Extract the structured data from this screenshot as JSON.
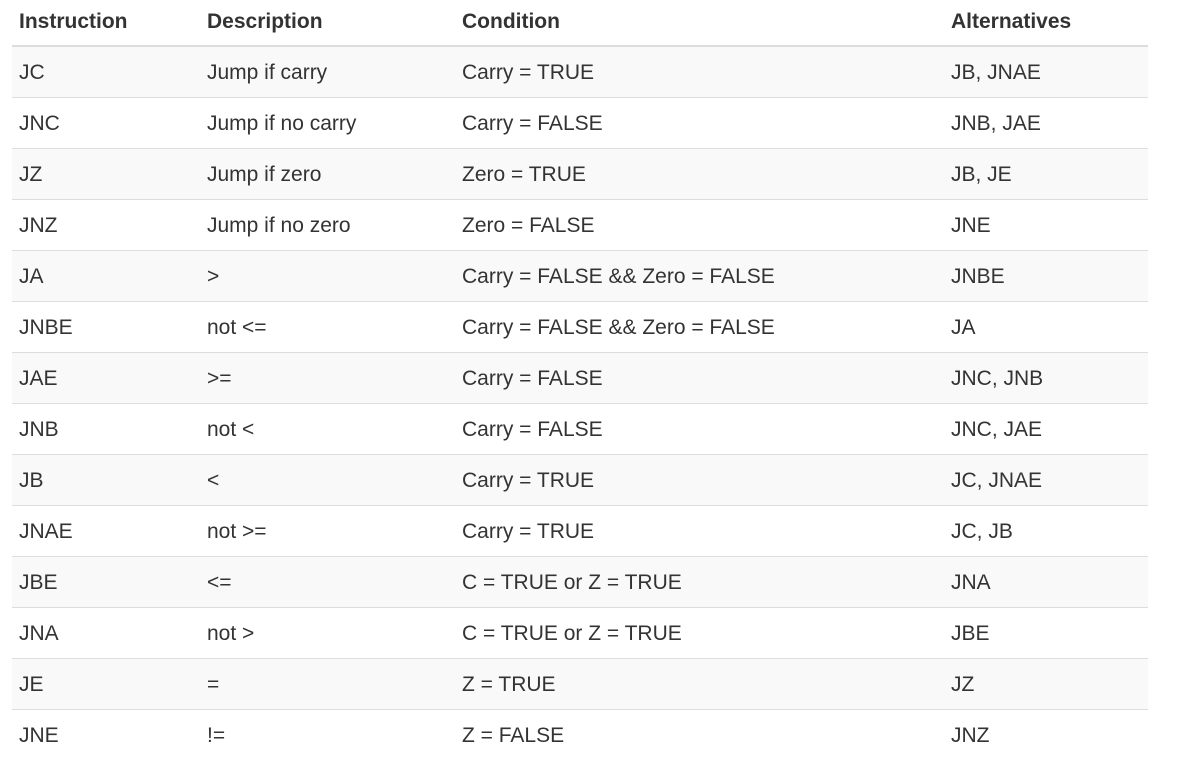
{
  "table": {
    "headers": [
      "Instruction",
      "Description",
      "Condition",
      "Alternatives"
    ],
    "rows": [
      [
        "JC",
        "Jump if carry",
        "Carry = TRUE",
        "JB, JNAE"
      ],
      [
        "JNC",
        "Jump if no carry",
        "Carry = FALSE",
        "JNB, JAE"
      ],
      [
        "JZ",
        "Jump if zero",
        "Zero = TRUE",
        "JB, JE"
      ],
      [
        "JNZ",
        "Jump if no zero",
        "Zero = FALSE",
        "JNE"
      ],
      [
        "JA",
        ">",
        "Carry = FALSE && Zero = FALSE",
        "JNBE"
      ],
      [
        "JNBE",
        "not <=",
        "Carry = FALSE && Zero = FALSE",
        "JA"
      ],
      [
        "JAE",
        ">=",
        "Carry = FALSE",
        "JNC, JNB"
      ],
      [
        "JNB",
        "not <",
        "Carry = FALSE",
        "JNC, JAE"
      ],
      [
        "JB",
        "<",
        "Carry = TRUE",
        "JC, JNAE"
      ],
      [
        "JNAE",
        "not >=",
        "Carry = TRUE",
        "JC, JB"
      ],
      [
        "JBE",
        "<=",
        "C = TRUE or Z = TRUE",
        "JNA"
      ],
      [
        "JNA",
        "not >",
        "C = TRUE or Z = TRUE",
        "JBE"
      ],
      [
        "JE",
        "=",
        "Z = TRUE",
        "JZ"
      ],
      [
        "JNE",
        "!=",
        "Z = FALSE",
        "JNZ"
      ]
    ]
  }
}
